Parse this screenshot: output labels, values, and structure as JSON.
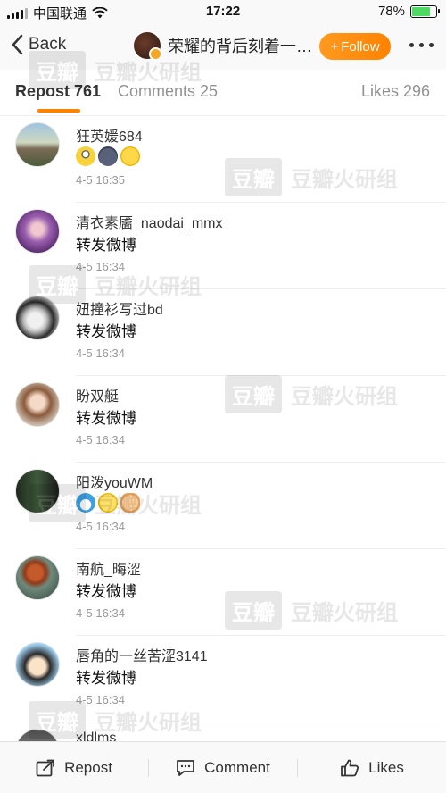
{
  "status_bar": {
    "carrier": "中国联通",
    "time": "17:22",
    "battery_percent": "78%",
    "battery_level": 0.78
  },
  "nav": {
    "back_label": "Back",
    "title": "荣耀的背后刻着一道孤独",
    "follow_label": "Follow",
    "follow_plus": "+"
  },
  "tabs": {
    "repost": "Repost 761",
    "comments": "Comments 25",
    "likes": "Likes 296"
  },
  "watermark": {
    "box": "豆瓣",
    "text": "豆瓣火研组"
  },
  "reposts": [
    {
      "name": "狂英媛684",
      "content": "",
      "emojis": [
        "minion-emoji",
        "cat-emoji",
        "grin-emoji"
      ],
      "time": "4-5 16:35"
    },
    {
      "name": "清衣素靥_naodai_mmx",
      "content": "转发微博",
      "emojis": [],
      "time": "4-5 16:34"
    },
    {
      "name": "妞撞衫写过bd",
      "content": "转发微博",
      "emojis": [],
      "time": "4-5 16:34"
    },
    {
      "name": "盼双艇",
      "content": "转发微博",
      "emojis": [],
      "time": "4-5 16:34"
    },
    {
      "name": "阳泼youWM",
      "content": "",
      "emojis": [
        "doraemon-emoji",
        "dizzy-emoji",
        "fist-emoji"
      ],
      "time": "4-5 16:34"
    },
    {
      "name": "南航_晦涩",
      "content": "转发微博",
      "emojis": [],
      "time": "4-5 16:34"
    },
    {
      "name": "唇角的一丝苦涩3141",
      "content": "转发微博",
      "emojis": [],
      "time": "4-5 16:34"
    },
    {
      "name": "xldlms",
      "content": "",
      "emojis": [],
      "time": ""
    }
  ],
  "bottom_bar": {
    "repost": "Repost",
    "comment": "Comment",
    "likes": "Likes"
  },
  "colors": {
    "accent": "#ff8200",
    "battery": "#4cd964"
  }
}
